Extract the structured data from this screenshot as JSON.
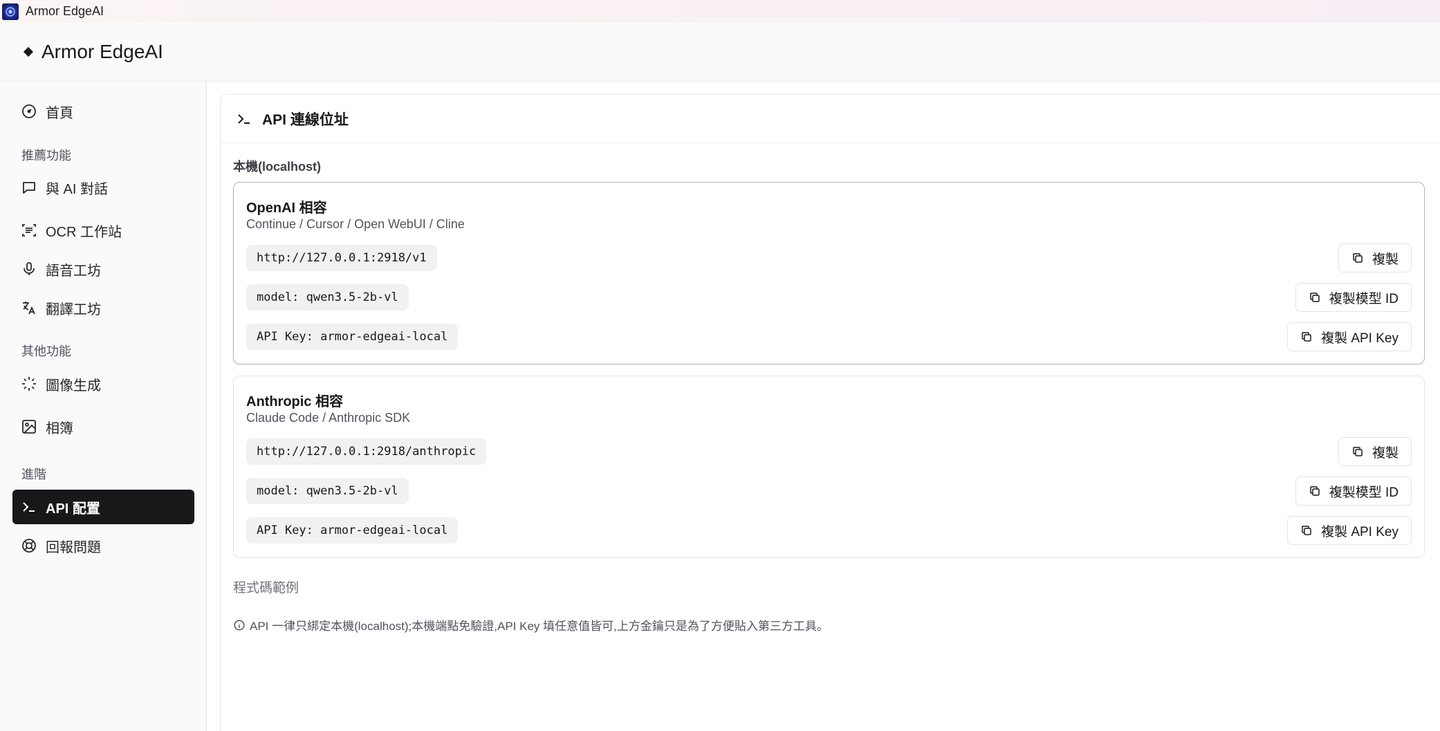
{
  "window": {
    "title": "Armor EdgeAI"
  },
  "header": {
    "brand": "Armor EdgeAI"
  },
  "sidebar": {
    "home": "首頁",
    "section_recommended": "推薦功能",
    "chat": "與 AI 對話",
    "ocr": "OCR 工作站",
    "voice": "語音工坊",
    "translate": "翻譯工坊",
    "section_other": "其他功能",
    "image_gen": "圖像生成",
    "album": "相簿",
    "section_advanced": "進階",
    "api_config": "API 配置",
    "report": "回報問題"
  },
  "main": {
    "title": "API 連線位址",
    "local_label": "本機(localhost)",
    "openai": {
      "title": "OpenAI 相容",
      "subtitle": "Continue / Cursor / Open WebUI / Cline",
      "url": "http://127.0.0.1:2918/v1",
      "model": "model: qwen3.5-2b-vl",
      "apikey": "API Key: armor-edgeai-local"
    },
    "anthropic": {
      "title": "Anthropic 相容",
      "subtitle": "Claude Code / Anthropic SDK",
      "url": "http://127.0.0.1:2918/anthropic",
      "model": "model: qwen3.5-2b-vl",
      "apikey": "API Key: armor-edgeai-local"
    },
    "buttons": {
      "copy": "複製",
      "copy_model": "複製模型 ID",
      "copy_key": "複製 API Key"
    },
    "code_examples": "程式碼範例",
    "note": "API 一律只綁定本機(localhost);本機端點免驗證,API Key 填任意值皆可,上方金鑰只是為了方便貼入第三方工具。"
  }
}
